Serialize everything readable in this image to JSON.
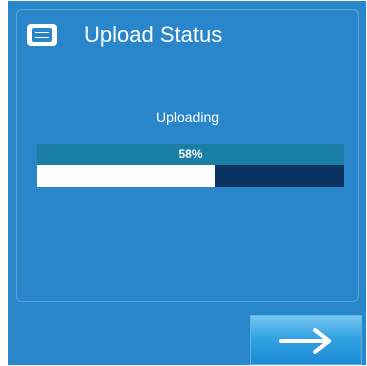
{
  "header": {
    "title": "Upload Status",
    "icon": "message-icon"
  },
  "status": {
    "label": "Uploading"
  },
  "progress": {
    "percent_label": "58%",
    "value": 0.58
  },
  "next_button": {
    "icon": "arrow-right-icon"
  },
  "colors": {
    "background": "#2a86ca",
    "progress_label_bg": "#1b7ea6",
    "progress_track": "#0c3262",
    "progress_fill": "#ffffff"
  }
}
